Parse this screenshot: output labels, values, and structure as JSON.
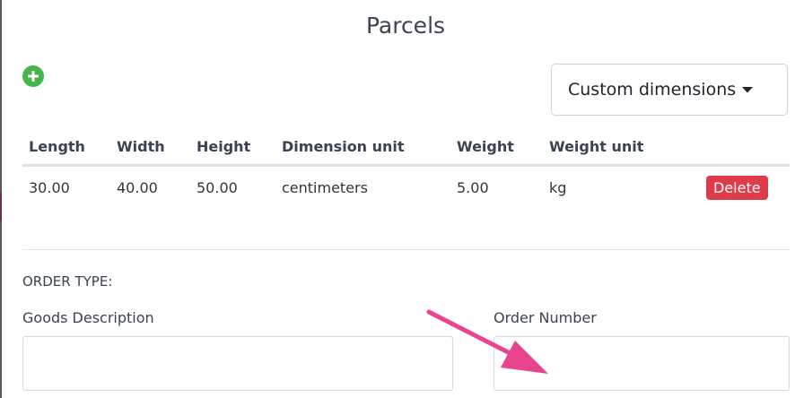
{
  "title": "Parcels",
  "add_icon": "plus-circle-icon",
  "dimensions_button": {
    "label": "Custom dimensions",
    "icon": "caret-down-icon"
  },
  "parcels_table": {
    "headers": [
      "Length",
      "Width",
      "Height",
      "Dimension unit",
      "Weight",
      "Weight unit"
    ],
    "rows": [
      {
        "length": "30.00",
        "width": "40.00",
        "height": "50.00",
        "dimension_unit": "centimeters",
        "weight": "5.00",
        "weight_unit": "kg",
        "delete_label": "Delete"
      }
    ]
  },
  "order_type_label": "ORDER TYPE:",
  "fields": {
    "goods_description": {
      "label": "Goods Description",
      "value": ""
    },
    "order_number": {
      "label": "Order Number",
      "value": ""
    }
  },
  "annotation": {
    "icon": "pointer-arrow-icon",
    "color": "#e8448f"
  },
  "colors": {
    "add": "#44b54a",
    "delete": "#e03b4a"
  }
}
